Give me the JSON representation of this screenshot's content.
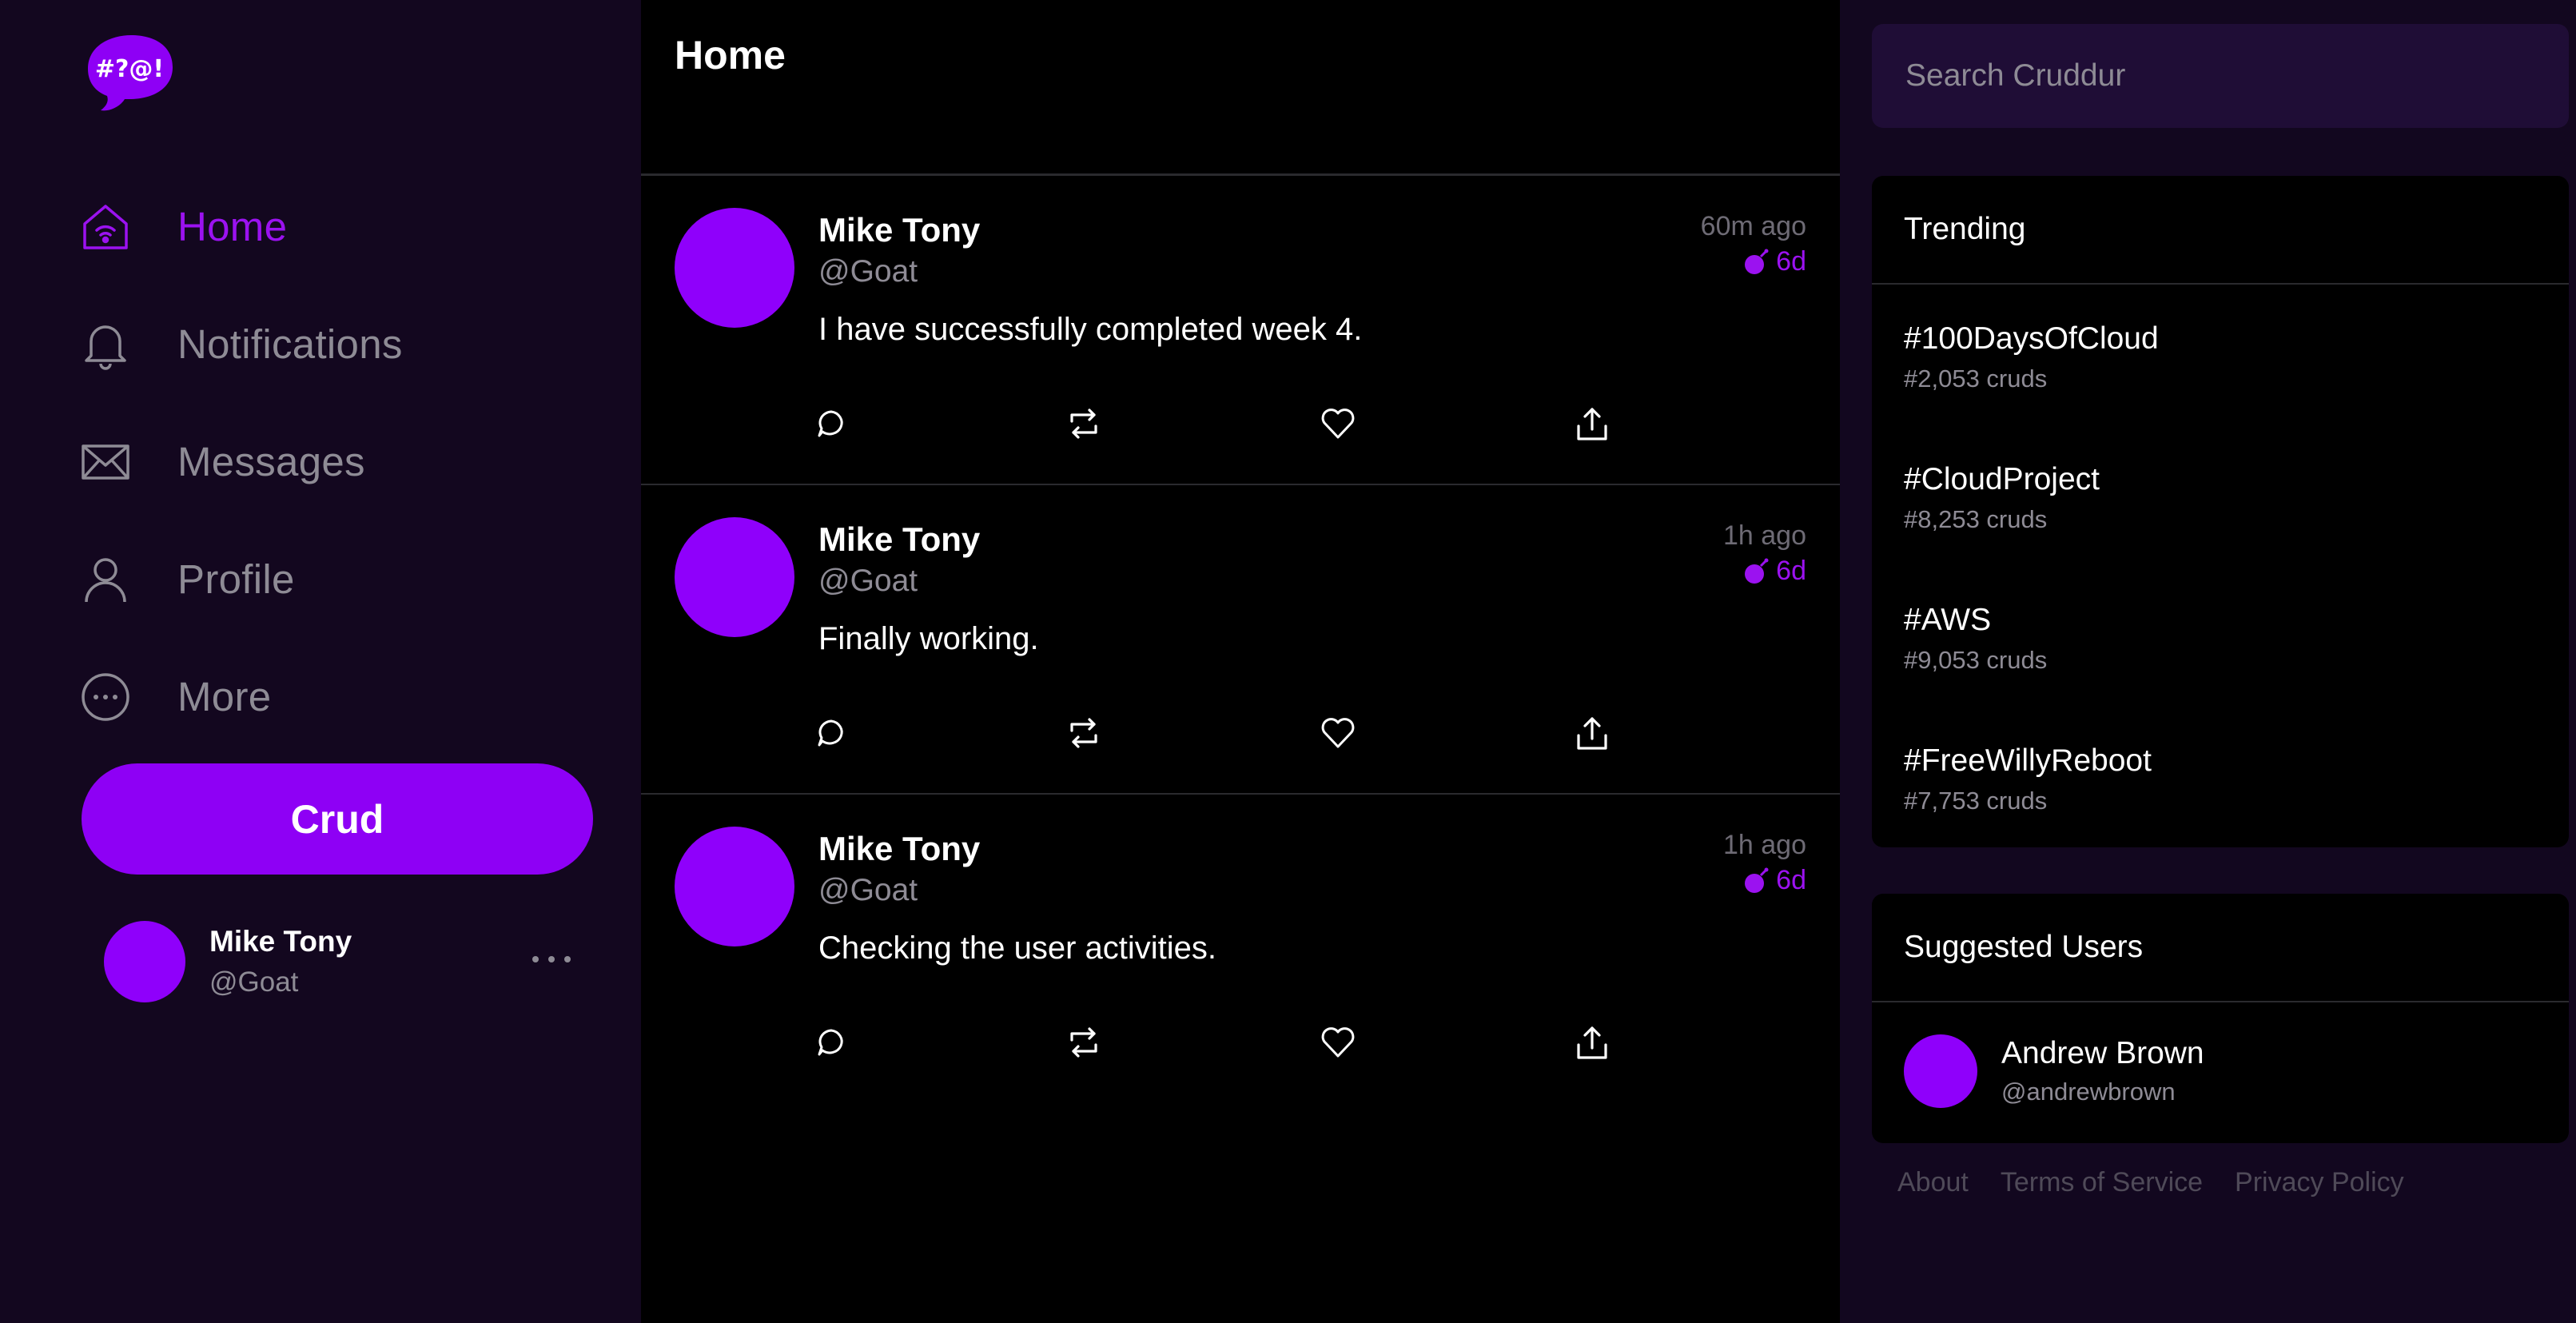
{
  "brand": {
    "logo_text": "#?@!",
    "accent": "#8e00f5",
    "background": "#12071f"
  },
  "sidebar": {
    "items": [
      {
        "label": "Home",
        "icon": "home-icon",
        "active": true
      },
      {
        "label": "Notifications",
        "icon": "bell-icon",
        "active": false
      },
      {
        "label": "Messages",
        "icon": "envelope-icon",
        "active": false
      },
      {
        "label": "Profile",
        "icon": "user-icon",
        "active": false
      },
      {
        "label": "More",
        "icon": "more-circle-icon",
        "active": false
      }
    ],
    "crud_button": "Crud",
    "profile": {
      "name": "Mike Tony",
      "handle": "@Goat"
    }
  },
  "feed": {
    "title": "Home",
    "posts": [
      {
        "name": "Mike Tony",
        "handle": "@Goat",
        "text": "I have successfully completed week 4.",
        "time": "60m ago",
        "expires": "6d"
      },
      {
        "name": "Mike Tony",
        "handle": "@Goat",
        "text": "Finally working.",
        "time": "1h ago",
        "expires": "6d"
      },
      {
        "name": "Mike Tony",
        "handle": "@Goat",
        "text": "Checking the user activities.",
        "time": "1h ago",
        "expires": "6d"
      }
    ]
  },
  "search": {
    "placeholder": "Search Cruddur"
  },
  "trending": {
    "title": "Trending",
    "items": [
      {
        "tag": "#100DaysOfCloud",
        "count": "#2,053 cruds"
      },
      {
        "tag": "#CloudProject",
        "count": "#8,253 cruds"
      },
      {
        "tag": "#AWS",
        "count": "#9,053 cruds"
      },
      {
        "tag": "#FreeWillyReboot",
        "count": "#7,753 cruds"
      }
    ]
  },
  "suggested": {
    "title": "Suggested Users",
    "users": [
      {
        "name": "Andrew Brown",
        "handle": "@andrewbrown"
      }
    ]
  },
  "footer": {
    "links": [
      "About",
      "Terms of Service",
      "Privacy Policy"
    ]
  }
}
